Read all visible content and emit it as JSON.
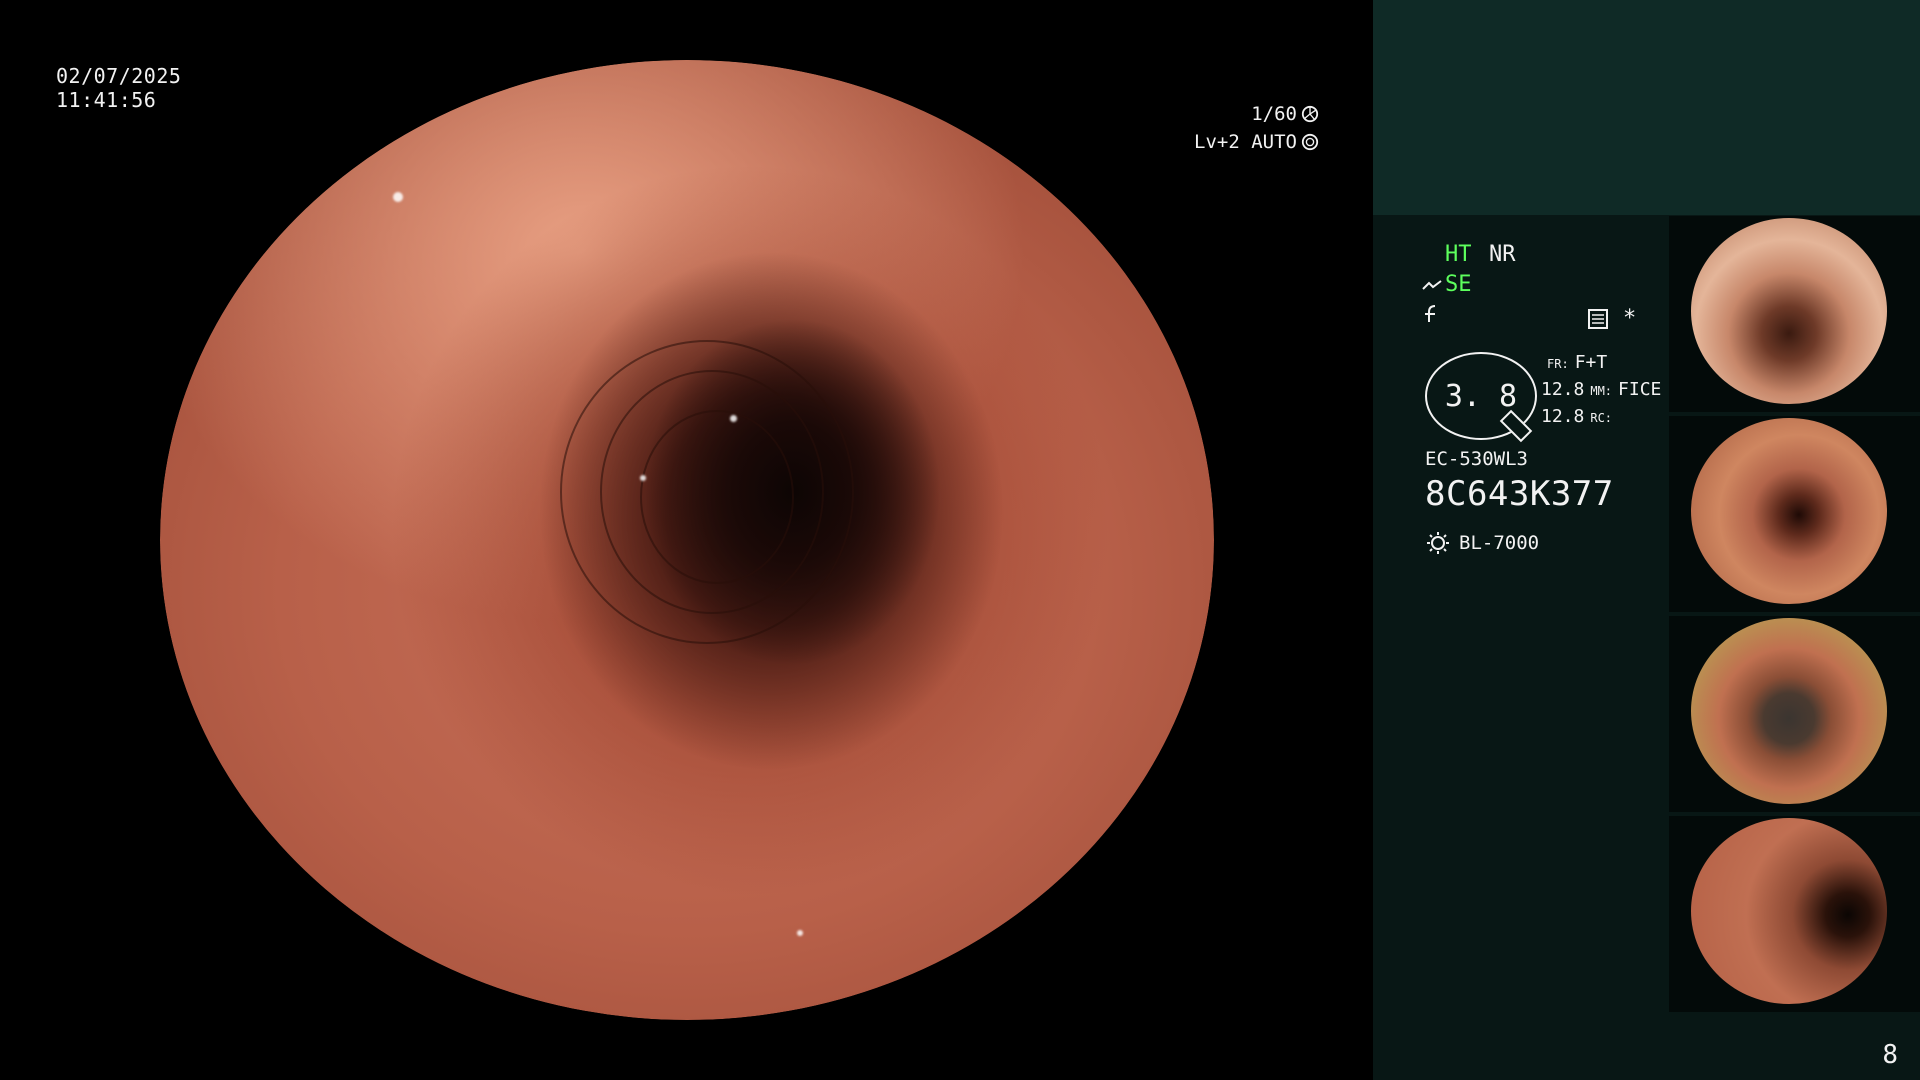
{
  "overlay": {
    "date": "02/07/2025",
    "time": "11:41:56",
    "shutter": "1/60",
    "iris": "Lv+2 AUTO"
  },
  "status": {
    "ht": "HT",
    "nr": "NR",
    "se": "SE",
    "star": "*"
  },
  "zoom": {
    "value": "3. 8",
    "fr_label": "FR:",
    "fr_value": "F+T",
    "mm_label": "MM:",
    "mm_value": "FICE",
    "rc_label": "RC:",
    "val1": "12.8",
    "val2": "12.8"
  },
  "scope": {
    "model": "EC-530WL3",
    "serial": "8C643K377",
    "light_source": "BL-7000"
  },
  "page": {
    "number": "8"
  },
  "icons": [
    "shutter-icon",
    "iris-icon",
    "se-icon",
    "f-icon",
    "storage-icon",
    "lens-icon",
    "light-source-icon"
  ]
}
